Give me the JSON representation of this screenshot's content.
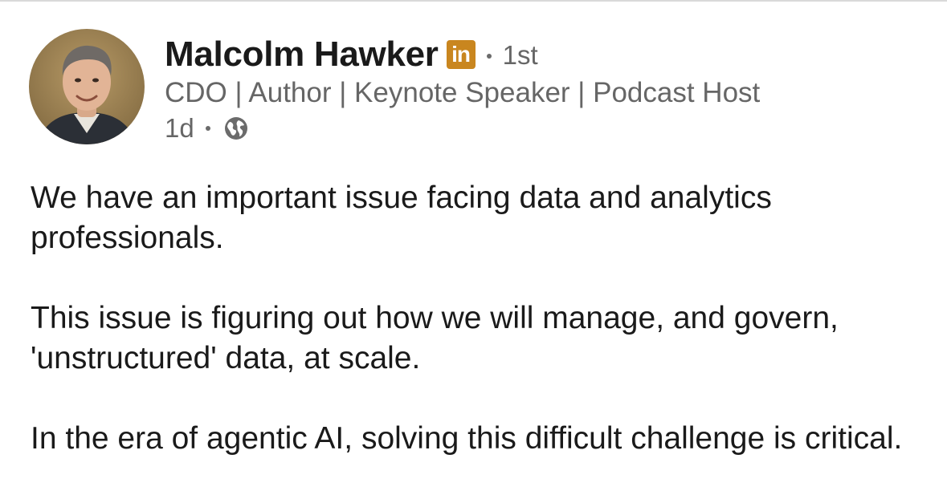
{
  "author": {
    "name": "Malcolm Hawker",
    "network_badge": "in",
    "connection_degree": "1st",
    "headline": "CDO | Author | Keynote Speaker | Podcast Host",
    "posted_ago": "1d",
    "visibility_icon": "globe-icon",
    "avatar_icon": "profile-photo"
  },
  "post": {
    "paragraphs": [
      "We have an important issue facing data and analytics professionals.",
      "This issue is figuring out how we will manage, and govern, 'unstructured' data, at scale.",
      "In the era of agentic AI,  solving this difficult challenge is critical."
    ]
  },
  "colors": {
    "badge": "#c9861f",
    "secondary_text": "#666666",
    "primary_text": "#1a1a1a"
  }
}
